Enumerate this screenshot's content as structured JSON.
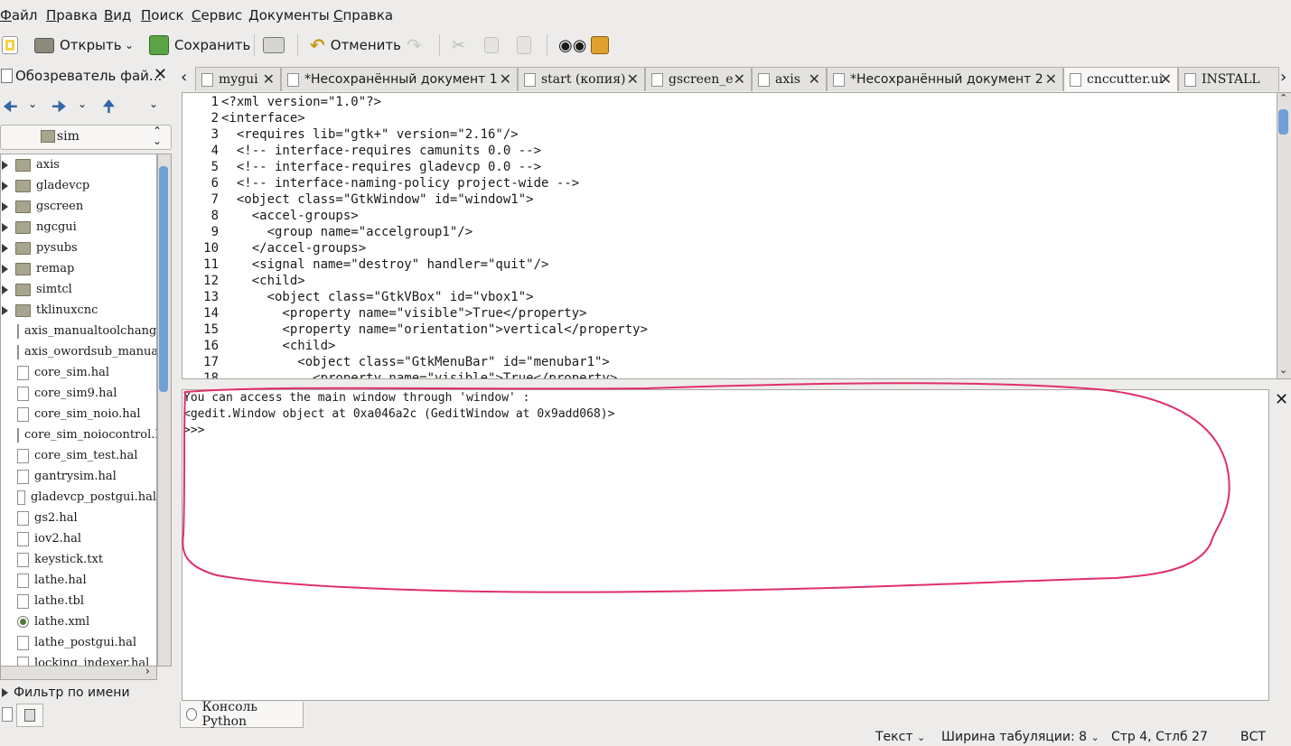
{
  "menubar": [
    "Файл",
    "Правка",
    "Вид",
    "Поиск",
    "Сервис",
    "Документы",
    "Справка"
  ],
  "toolbar": {
    "open_label": "Открыть",
    "save_label": "Сохранить",
    "undo_label": "Отменить"
  },
  "sidebar": {
    "title": "Обозреватель фай...",
    "location": "sim",
    "items": [
      {
        "name": "axis",
        "type": "folder"
      },
      {
        "name": "gladevcp",
        "type": "folder"
      },
      {
        "name": "gscreen",
        "type": "folder"
      },
      {
        "name": "ngcgui",
        "type": "folder"
      },
      {
        "name": "pysubs",
        "type": "folder"
      },
      {
        "name": "remap",
        "type": "folder"
      },
      {
        "name": "simtcl",
        "type": "folder"
      },
      {
        "name": "tklinuxcnc",
        "type": "folder"
      },
      {
        "name": "axis_manualtoolchange",
        "type": "file"
      },
      {
        "name": "axis_owordsub_manual",
        "type": "file"
      },
      {
        "name": "core_sim.hal",
        "type": "file"
      },
      {
        "name": "core_sim9.hal",
        "type": "file"
      },
      {
        "name": "core_sim_noio.hal",
        "type": "file"
      },
      {
        "name": "core_sim_noiocontrol.h",
        "type": "file"
      },
      {
        "name": "core_sim_test.hal",
        "type": "file"
      },
      {
        "name": "gantrysim.hal",
        "type": "file"
      },
      {
        "name": "gladevcp_postgui.hal",
        "type": "file"
      },
      {
        "name": "gs2.hal",
        "type": "file"
      },
      {
        "name": "iov2.hal",
        "type": "file"
      },
      {
        "name": "keystick.txt",
        "type": "file"
      },
      {
        "name": "lathe.hal",
        "type": "file"
      },
      {
        "name": "lathe.tbl",
        "type": "file"
      },
      {
        "name": "lathe.xml",
        "type": "xml"
      },
      {
        "name": "lathe_postgui.hal",
        "type": "file"
      },
      {
        "name": "locking_indexer.hal",
        "type": "file"
      }
    ],
    "filter_label": "Фильтр по имени"
  },
  "tabs": [
    {
      "label": "mygui",
      "serif": true,
      "active": false
    },
    {
      "label": "*Несохранённый документ 1",
      "serif": false,
      "active": false
    },
    {
      "label": "start (копия)",
      "serif": true,
      "active": false
    },
    {
      "label": "gscreen_e",
      "serif": true,
      "active": false
    },
    {
      "label": "axis",
      "serif": true,
      "active": false
    },
    {
      "label": "*Несохранённый документ 2",
      "serif": false,
      "active": false
    },
    {
      "label": "cnccutter.ui",
      "serif": true,
      "active": true
    },
    {
      "label": "INSTALL",
      "serif": true,
      "active": false
    }
  ],
  "editor": {
    "lines": [
      "<?xml version=\"1.0\"?>",
      "<interface>",
      "  <requires lib=\"gtk+\" version=\"2.16\"/>",
      "  <!-- interface-requires camunits 0.0 -->",
      "  <!-- interface-requires gladevcp 0.0 -->",
      "  <!-- interface-naming-policy project-wide -->",
      "  <object class=\"GtkWindow\" id=\"window1\">",
      "    <accel-groups>",
      "      <group name=\"accelgroup1\"/>",
      "    </accel-groups>",
      "    <signal name=\"destroy\" handler=\"quit\"/>",
      "    <child>",
      "      <object class=\"GtkVBox\" id=\"vbox1\">",
      "        <property name=\"visible\">True</property>",
      "        <property name=\"orientation\">vertical</property>",
      "        <child>",
      "          <object class=\"GtkMenuBar\" id=\"menubar1\">",
      "            <property name=\"visible\">True</property>"
    ]
  },
  "console": {
    "lines": [
      "You can access the main window through 'window' :",
      "<gedit.Window object at 0xa046a2c (GeditWindow at 0x9add068)>",
      ">>>"
    ],
    "annotation_color": "#e0306a"
  },
  "bottom_panel": {
    "tab_label": "Консоль Python"
  },
  "statusbar": {
    "syntax": "Текст",
    "tab_width": "Ширина табуляции:  8",
    "position": "Стр 4, Стлб 27",
    "mode": "ВСТ"
  },
  "colors": {
    "selection": "#6fa0d6",
    "background": "#edeceb"
  }
}
